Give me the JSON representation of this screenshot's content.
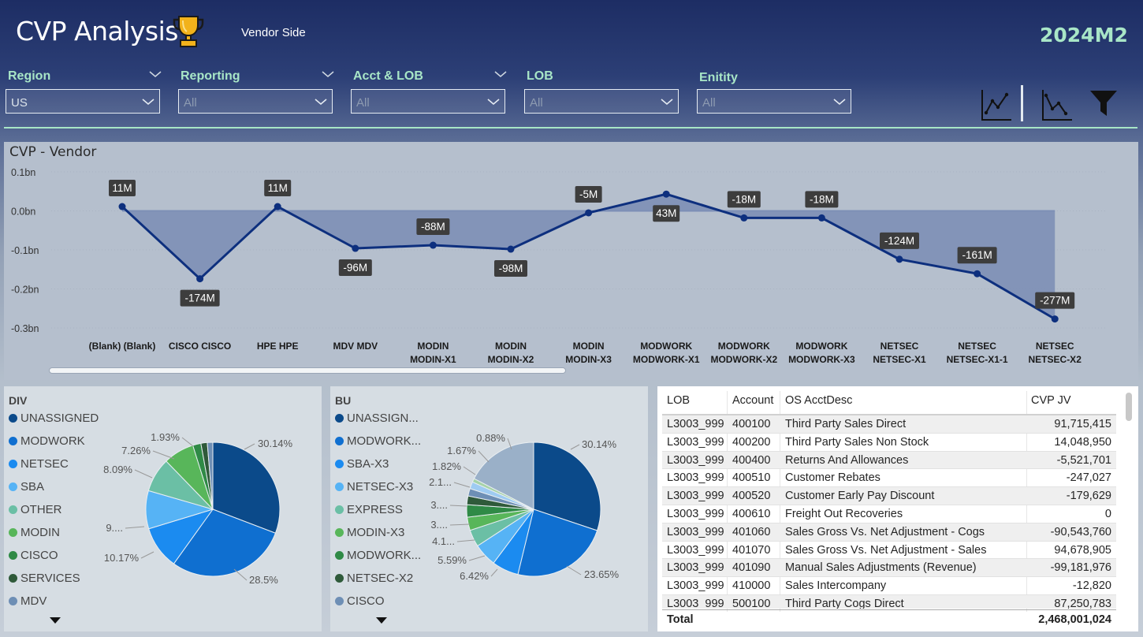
{
  "header": {
    "title": "CVP Analysis",
    "subtitle": "Vendor Side",
    "period": "2024M2"
  },
  "slicers": [
    {
      "label": "Region",
      "value": "US"
    },
    {
      "label": "Reporting",
      "value": "All"
    },
    {
      "label": "Acct & LOB",
      "value": "All"
    },
    {
      "label": "LOB",
      "value": "All"
    },
    {
      "label": "Enitity",
      "value": "All"
    }
  ],
  "colors": {
    "accent": "#a8e6c7",
    "line": "#0d2f7e",
    "area": "#7a8fb8",
    "label_bg": "#3d3d3d"
  },
  "icons": {
    "title": "trophy-icon",
    "toolbar": [
      "line-chart-up-icon",
      "line-chart-down-icon",
      "filter-icon"
    ]
  },
  "chart_data": [
    {
      "type": "line",
      "title": "CVP - Vendor",
      "categories": [
        "(Blank) (Blank)",
        "CISCO CISCO",
        "HPE HPE",
        "MDV MDV",
        "MODIN MODIN-X1",
        "MODIN MODIN-X2",
        "MODIN MODIN-X3",
        "MODWORK MODWORK-X1",
        "MODWORK MODWORK-X2",
        "MODWORK MODWORK-X3",
        "NETSEC NETSEC-X1",
        "NETSEC NETSEC-X1-1",
        "NETSEC NETSEC-X2"
      ],
      "category_lines": [
        [
          "(Blank) (Blank)"
        ],
        [
          "CISCO CISCO"
        ],
        [
          "HPE HPE"
        ],
        [
          "MDV MDV"
        ],
        [
          "MODIN",
          "MODIN-X1"
        ],
        [
          "MODIN",
          "MODIN-X2"
        ],
        [
          "MODIN",
          "MODIN-X3"
        ],
        [
          "MODWORK",
          "MODWORK-X1"
        ],
        [
          "MODWORK",
          "MODWORK-X2"
        ],
        [
          "MODWORK",
          "MODWORK-X3"
        ],
        [
          "NETSEC",
          "NETSEC-X1"
        ],
        [
          "NETSEC",
          "NETSEC-X1-1"
        ],
        [
          "NETSEC",
          "NETSEC-X2"
        ]
      ],
      "values": [
        11,
        -174,
        11,
        -96,
        -88,
        -98,
        -5,
        43,
        -18,
        -18,
        -124,
        -161,
        -277
      ],
      "value_units": "M",
      "data_labels": [
        "11M",
        "-174M",
        "11M",
        "-96M",
        "-88M",
        "-98M",
        "-5M",
        "43M",
        "-18M",
        "-18M",
        "-124M",
        "-161M",
        "-277M"
      ],
      "yticks": [
        "0.1bn",
        "0.0bn",
        "-0.1bn",
        "-0.2bn",
        "-0.3bn"
      ],
      "ytick_values": [
        100,
        0,
        -100,
        -200,
        -300
      ],
      "ylim": [
        -300,
        100
      ],
      "area_fill": true,
      "grid": false,
      "legend": "none"
    },
    {
      "type": "pie",
      "title": "DIV",
      "categories": [
        "UNASSIGNED",
        "MODWORK",
        "NETSEC",
        "SBA",
        "OTHER",
        "MODIN",
        "CISCO",
        "SERVICES",
        "MDV"
      ],
      "values": [
        30.14,
        28.5,
        10.17,
        9.0,
        8.09,
        7.26,
        1.93,
        1.5,
        1.3
      ],
      "colors": [
        "#0b4a8a",
        "#0f6fd0",
        "#1b8bf0",
        "#56b3f5",
        "#6bbfa5",
        "#58b65a",
        "#2f8a46",
        "#2f5a3a",
        "#6e8fb5"
      ],
      "labels": [
        "30.14%",
        "28.5%",
        "10.17%",
        "9....",
        "8.09%",
        "7.26%",
        "1.93%",
        "",
        ""
      ],
      "legend": "left"
    },
    {
      "type": "pie",
      "title": "BU",
      "categories": [
        "UNASSIGN...",
        "MODWORK...",
        "SBA-X3",
        "NETSEC-X3",
        "EXPRESS",
        "MODIN-X3",
        "MODWORK...",
        "NETSEC-X2",
        "CISCO"
      ],
      "values": [
        30.14,
        23.65,
        6.42,
        5.59,
        4.1,
        3.2,
        3.0,
        2.1,
        1.82,
        1.67,
        0.88,
        17.43
      ],
      "colors": [
        "#0b4a8a",
        "#0f6fd0",
        "#1b8bf0",
        "#56b3f5",
        "#6bbfa5",
        "#58b65a",
        "#2f8a46",
        "#2f5a3a",
        "#6e8fb5",
        "#9ecbf2",
        "#a6d3a8",
        "#9ab0c8"
      ],
      "labels": [
        "30.14%",
        "23.65%",
        "6.42%",
        "5.59%",
        "4.1...",
        "3....",
        "3....",
        "2.1...",
        "1.82%",
        "1.67%",
        "0.88%",
        ""
      ],
      "legend": "left"
    }
  ],
  "table": {
    "columns": [
      "LOB",
      "Account",
      "OS AcctDesc",
      "CVP JV"
    ],
    "rows": [
      [
        "L3003_999",
        "400100",
        "Third Party Sales Direct",
        "91,715,415"
      ],
      [
        "L3003_999",
        "400200",
        "Third Party Sales Non Stock",
        "14,048,950"
      ],
      [
        "L3003_999",
        "400400",
        "Returns And Allowances",
        "-5,521,701"
      ],
      [
        "L3003_999",
        "400510",
        "Customer Rebates",
        "-247,027"
      ],
      [
        "L3003_999",
        "400520",
        "Customer Early Pay Discount",
        "-179,629"
      ],
      [
        "L3003_999",
        "400610",
        "Freight Out Recoveries",
        "0"
      ],
      [
        "L3003_999",
        "401060",
        "Sales Gross Vs. Net Adjustment - Cogs",
        "-90,543,760"
      ],
      [
        "L3003_999",
        "401070",
        "Sales Gross Vs. Net Adjustment - Sales",
        "94,678,905"
      ],
      [
        "L3003_999",
        "401090",
        "Manual Sales Adjustments (Revenue)",
        "-99,181,976"
      ],
      [
        "L3003_999",
        "410000",
        "Sales Intercompany",
        "-12,820"
      ],
      [
        "L3003_999",
        "500100",
        "Third Party Cogs Direct",
        "87,250,783"
      ]
    ],
    "total_label": "Total",
    "total_value": "2,468,001,024"
  }
}
